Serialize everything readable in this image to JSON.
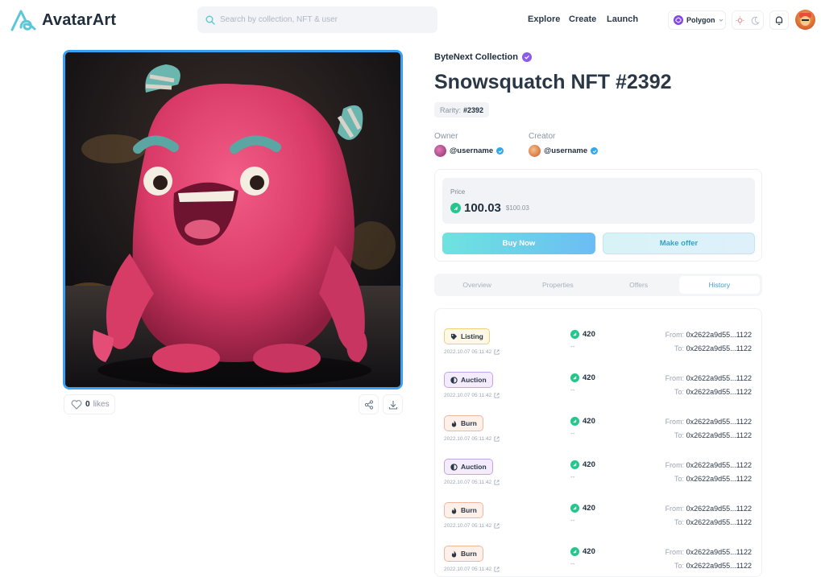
{
  "header": {
    "logo_text": "AvatarArt",
    "search_placeholder": "Search by collection, NFT & user",
    "nav": [
      "Explore",
      "Create",
      "Launch"
    ],
    "network": "Polygon"
  },
  "nft": {
    "collection": "ByteNext Collection",
    "title": "Snowsquatch NFT #2392",
    "rarity_label": "Rarity:",
    "rarity_value": "#2392",
    "likes_count": "0",
    "likes_label": "likes"
  },
  "people": {
    "owner_label": "Owner",
    "owner_name": "@username",
    "creator_label": "Creator",
    "creator_name": "@username"
  },
  "price": {
    "label": "Price",
    "value": "100.03",
    "usd": "$100.03",
    "buy_label": "Buy Now",
    "offer_label": "Make offer"
  },
  "tabs": [
    "Overview",
    "Properties",
    "Offers",
    "History"
  ],
  "history": [
    {
      "type": "Listing",
      "kind": "listing",
      "date": "2022.10.07 05:11:42",
      "amount": "420",
      "sub": "--",
      "from_label": "From:",
      "from": "0x2622a9d55...1122",
      "to_label": "To:",
      "to": "0x2622a9d55...1122"
    },
    {
      "type": "Auction",
      "kind": "auction",
      "date": "2022.10.07 05:11:42",
      "amount": "420",
      "sub": "--",
      "from_label": "From:",
      "from": "0x2622a9d55...1122",
      "to_label": "To:",
      "to": "0x2622a9d55...1122"
    },
    {
      "type": "Burn",
      "kind": "burn",
      "date": "2022.10.07 05:11:42",
      "amount": "420",
      "sub": "--",
      "from_label": "From:",
      "from": "0x2622a9d55...1122",
      "to_label": "To:",
      "to": "0x2622a9d55...1122"
    },
    {
      "type": "Auction",
      "kind": "auction",
      "date": "2022.10.07 05:11:42",
      "amount": "420",
      "sub": "--",
      "from_label": "From:",
      "from": "0x2622a9d55...1122",
      "to_label": "To:",
      "to": "0x2622a9d55...1122"
    },
    {
      "type": "Burn",
      "kind": "burn",
      "date": "2022.10.07 05:11:42",
      "amount": "420",
      "sub": "--",
      "from_label": "From:",
      "from": "0x2622a9d55...1122",
      "to_label": "To:",
      "to": "0x2622a9d55...1122"
    },
    {
      "type": "Burn",
      "kind": "burn",
      "date": "2022.10.07 05:11:42",
      "amount": "420",
      "sub": "--",
      "from_label": "From:",
      "from": "0x2622a9d55...1122",
      "to_label": "To:",
      "to": "0x2622a9d55...1122"
    }
  ],
  "colors": {
    "accent": "#3aa0f2",
    "verified": "#8c5ae8",
    "coin": "#22c78b"
  }
}
